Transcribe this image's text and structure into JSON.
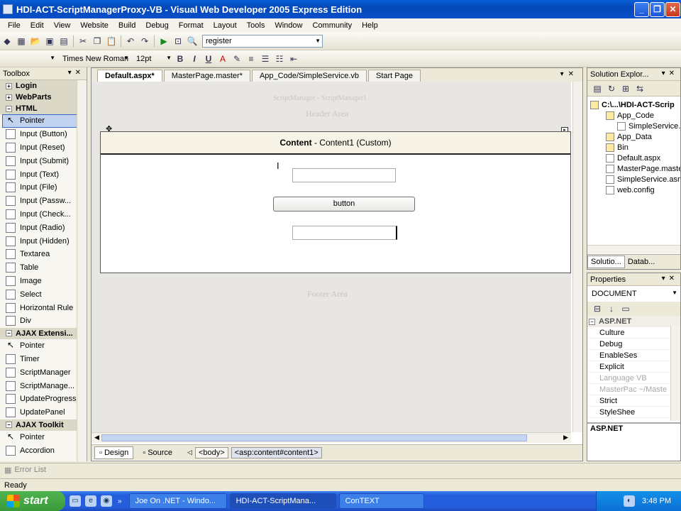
{
  "window": {
    "title": "HDI-ACT-ScriptManagerProxy-VB - Visual Web Developer 2005 Express Edition"
  },
  "menu": [
    "File",
    "Edit",
    "View",
    "Website",
    "Build",
    "Debug",
    "Format",
    "Layout",
    "Tools",
    "Window",
    "Community",
    "Help"
  ],
  "toolbar": {
    "find_value": "register",
    "font_name": "Times New Roman",
    "font_size": "12pt",
    "bold": "B",
    "italic": "I",
    "underline": "U"
  },
  "toolbox": {
    "title": "Toolbox",
    "groups_top": [
      {
        "sign": "+",
        "label": "Login"
      },
      {
        "sign": "+",
        "label": "WebParts"
      }
    ],
    "html_group": {
      "sign": "−",
      "label": "HTML"
    },
    "html_items": [
      "Pointer",
      "Input (Button)",
      "Input (Reset)",
      "Input (Submit)",
      "Input (Text)",
      "Input (File)",
      "Input (Passw...",
      "Input (Check...",
      "Input (Radio)",
      "Input (Hidden)",
      "Textarea",
      "Table",
      "Image",
      "Select",
      "Horizontal Rule",
      "Div"
    ],
    "ajax_group": {
      "sign": "−",
      "label": "AJAX Extensi..."
    },
    "ajax_items": [
      "Pointer",
      "Timer",
      "ScriptManager",
      "ScriptManage...",
      "UpdateProgress",
      "UpdatePanel"
    ],
    "toolkit_group": {
      "sign": "−",
      "label": "AJAX Toolkit"
    },
    "toolkit_items": [
      "Pointer",
      "Accordion"
    ]
  },
  "tabs": [
    "Default.aspx*",
    "MasterPage.master*",
    "App_Code/SimpleService.vb",
    "Start Page"
  ],
  "design": {
    "ghost_script": "ScriptManager - ScriptManager1",
    "header_area": "Header Area",
    "content_label_bold": "Content",
    "content_label_rest": " - Content1 (Custom)",
    "button_text": "button",
    "footer_area": "Footer Area"
  },
  "viewbar": {
    "design": "Design",
    "source": "Source",
    "crumb1": "<body>",
    "crumb2": "<asp:content#content1>"
  },
  "solution": {
    "title": "Solution Explor...",
    "items": [
      {
        "label": "C:\\...\\HDI-ACT-Scrip",
        "indent": 0
      },
      {
        "label": "App_Code",
        "indent": 1
      },
      {
        "label": "SimpleService.v",
        "indent": 2
      },
      {
        "label": "App_Data",
        "indent": 1
      },
      {
        "label": "Bin",
        "indent": 1
      },
      {
        "label": "Default.aspx",
        "indent": 1
      },
      {
        "label": "MasterPage.maste",
        "indent": 1
      },
      {
        "label": "SimpleService.asm",
        "indent": 1
      },
      {
        "label": "web.config",
        "indent": 1
      }
    ],
    "tab1": "Solutio...",
    "tab2": "Datab..."
  },
  "properties": {
    "title": "Properties",
    "object": "DOCUMENT",
    "category": "ASP.NET",
    "rows": [
      {
        "name": "Culture",
        "disabled": false
      },
      {
        "name": "Debug",
        "disabled": false
      },
      {
        "name": "EnableSes",
        "disabled": false
      },
      {
        "name": "Explicit",
        "disabled": false
      },
      {
        "name": "Language VB",
        "disabled": true
      },
      {
        "name": "MasterPac ~/Maste",
        "disabled": true
      },
      {
        "name": "Strict",
        "disabled": false
      },
      {
        "name": "StyleShee",
        "disabled": false
      }
    ],
    "desc_title": "ASP.NET"
  },
  "error_list": "Error List",
  "status": "Ready",
  "taskbar": {
    "start": "start",
    "buttons": [
      "Joe On .NET - Windo...",
      "HDI-ACT-ScriptMana...",
      "ConTEXT"
    ],
    "clock": "3:48 PM"
  }
}
